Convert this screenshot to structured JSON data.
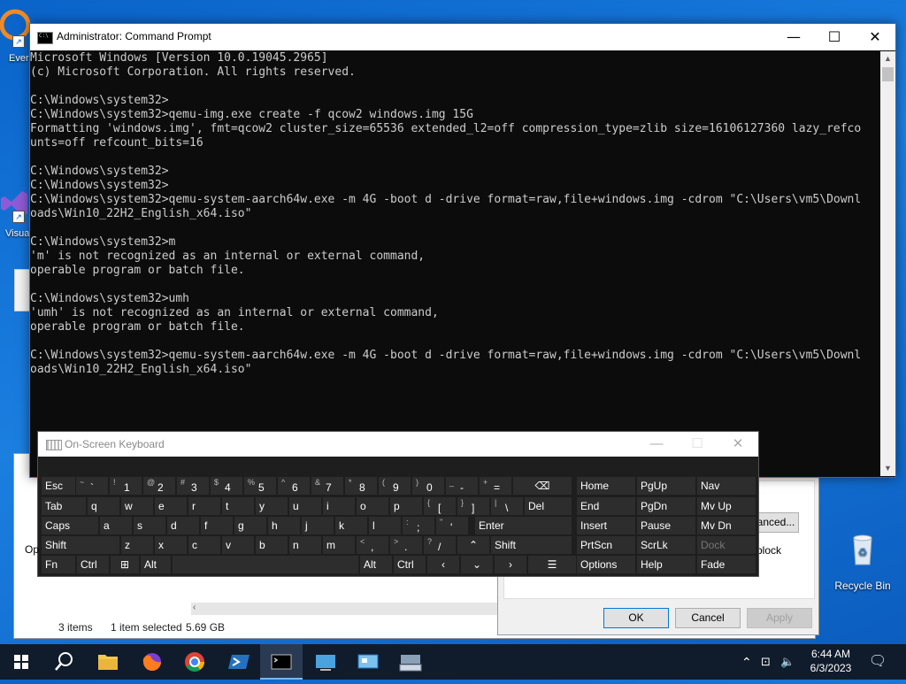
{
  "desktop": {
    "icons": [
      {
        "label": "Ever"
      },
      {
        "label": "Visua"
      },
      {
        "label": "Op"
      },
      {
        "label": "Recycle Bin"
      }
    ]
  },
  "explorer": {
    "status_items": "3 items",
    "status_selected": "1 item selected",
    "status_size": "5.69 GB"
  },
  "properties": {
    "advanced_label": "anced...",
    "block_label": "block",
    "ok_label": "OK",
    "cancel_label": "Cancel",
    "apply_label": "Apply"
  },
  "cmd": {
    "title": "Administrator: Command Prompt",
    "lines": [
      "Microsoft Windows [Version 10.0.19045.2965]",
      "(c) Microsoft Corporation. All rights reserved.",
      "",
      "C:\\Windows\\system32>",
      "C:\\Windows\\system32>qemu-img.exe create -f qcow2 windows.img 15G",
      "Formatting 'windows.img', fmt=qcow2 cluster_size=65536 extended_l2=off compression_type=zlib size=16106127360 lazy_refco",
      "unts=off refcount_bits=16",
      "",
      "C:\\Windows\\system32>",
      "C:\\Windows\\system32>",
      "C:\\Windows\\system32>qemu-system-aarch64w.exe -m 4G -boot d -drive format=raw,file+windows.img -cdrom \"C:\\Users\\vm5\\Downl",
      "oads\\Win10_22H2_English_x64.iso\"",
      "",
      "C:\\Windows\\system32>m",
      "'m' is not recognized as an internal or external command,",
      "operable program or batch file.",
      "",
      "C:\\Windows\\system32>umh",
      "'umh' is not recognized as an internal or external command,",
      "operable program or batch file.",
      "",
      "C:\\Windows\\system32>qemu-system-aarch64w.exe -m 4G -boot d -drive format=raw,file+windows.img -cdrom \"C:\\Users\\vm5\\Downl",
      "oads\\Win10_22H2_English_x64.iso\""
    ]
  },
  "osk": {
    "title": "On-Screen Keyboard",
    "rows": [
      [
        {
          "m": "Esc"
        },
        {
          "s": "~",
          "p": "`"
        },
        {
          "s": "!",
          "p": "1"
        },
        {
          "s": "@",
          "p": "2"
        },
        {
          "s": "#",
          "p": "3"
        },
        {
          "s": "$",
          "p": "4"
        },
        {
          "s": "%",
          "p": "5"
        },
        {
          "s": "^",
          "p": "6"
        },
        {
          "s": "&",
          "p": "7"
        },
        {
          "s": "*",
          "p": "8"
        },
        {
          "s": "(",
          "p": "9"
        },
        {
          "s": ")",
          "p": "0"
        },
        {
          "s": "_",
          "p": "-"
        },
        {
          "s": "+",
          "p": "="
        },
        {
          "m": "⌫"
        },
        {
          "m": "Home"
        },
        {
          "m": "PgUp"
        },
        {
          "m": "Nav"
        }
      ],
      [
        {
          "m": "Tab"
        },
        {
          "m": "q"
        },
        {
          "m": "w"
        },
        {
          "m": "e"
        },
        {
          "m": "r"
        },
        {
          "m": "t"
        },
        {
          "m": "y"
        },
        {
          "m": "u"
        },
        {
          "m": "i"
        },
        {
          "m": "o"
        },
        {
          "m": "p"
        },
        {
          "s": "{",
          "p": "["
        },
        {
          "s": "}",
          "p": "]"
        },
        {
          "s": "|",
          "p": "\\"
        },
        {
          "m": "Del"
        },
        {
          "m": "End"
        },
        {
          "m": "PgDn"
        },
        {
          "m": "Mv Up"
        }
      ],
      [
        {
          "m": "Caps"
        },
        {
          "m": "a"
        },
        {
          "m": "s"
        },
        {
          "m": "d"
        },
        {
          "m": "f"
        },
        {
          "m": "g"
        },
        {
          "m": "h"
        },
        {
          "m": "j"
        },
        {
          "m": "k"
        },
        {
          "m": "l"
        },
        {
          "s": ":",
          "p": ";"
        },
        {
          "s": "\"",
          "p": "'"
        },
        {
          "m": "Enter"
        },
        {
          "m": "Insert"
        },
        {
          "m": "Pause"
        },
        {
          "m": "Mv Dn"
        }
      ],
      [
        {
          "m": "Shift"
        },
        {
          "m": "z"
        },
        {
          "m": "x"
        },
        {
          "m": "c"
        },
        {
          "m": "v"
        },
        {
          "m": "b"
        },
        {
          "m": "n"
        },
        {
          "m": "m"
        },
        {
          "s": "<",
          "p": ","
        },
        {
          "s": ">",
          "p": "."
        },
        {
          "s": "?",
          "p": "/"
        },
        {
          "m": "⌃"
        },
        {
          "m": "Shift"
        },
        {
          "m": "PrtScn"
        },
        {
          "m": "ScrLk"
        },
        {
          "m": "Dock"
        }
      ],
      [
        {
          "m": "Fn"
        },
        {
          "m": "Ctrl"
        },
        {
          "m": "⊞"
        },
        {
          "m": "Alt"
        },
        {
          "m": ""
        },
        {
          "m": "Alt"
        },
        {
          "m": "Ctrl"
        },
        {
          "m": "‹"
        },
        {
          "m": "⌄"
        },
        {
          "m": "›"
        },
        {
          "m": "☰"
        },
        {
          "m": "Options"
        },
        {
          "m": "Help"
        },
        {
          "m": "Fade"
        }
      ]
    ]
  },
  "taskbar": {
    "time": "6:44 AM",
    "date": "6/3/2023"
  },
  "colors": {
    "accent": "#0078d7",
    "taskbar": "#101c2c",
    "desktop": "#0a63c9"
  }
}
